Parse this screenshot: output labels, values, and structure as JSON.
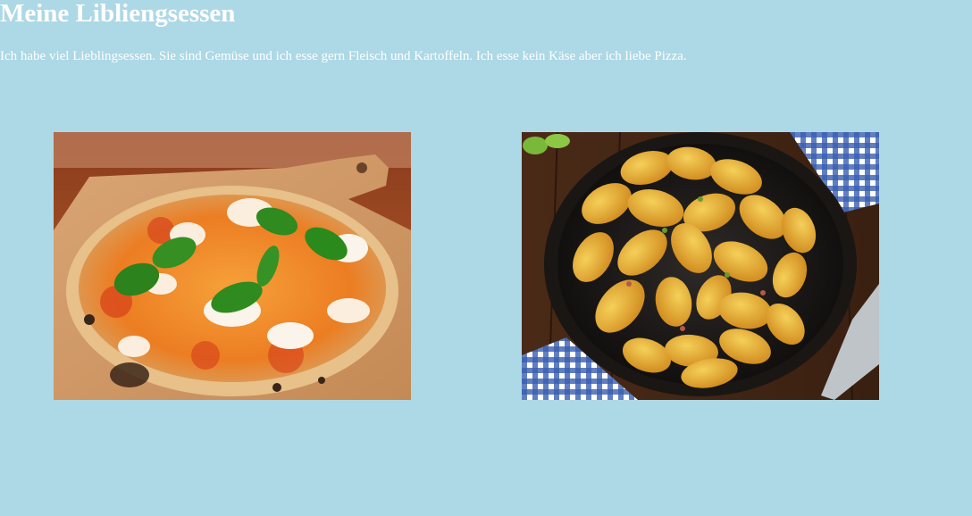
{
  "page": {
    "title": "Meine Libliengsessen",
    "intro": "Ich habe viel Lieblingsessen. Sie sind Gemüse und ich esse gern Fleisch und Kartoffeln. Ich esse kein Käse aber ich liebe Pizza."
  },
  "colors": {
    "background": "#add8e6",
    "text": "#ffffff"
  },
  "images": [
    {
      "subject": "pizza-margherita-icon"
    },
    {
      "subject": "fried-potatoes-pan-icon"
    }
  ]
}
